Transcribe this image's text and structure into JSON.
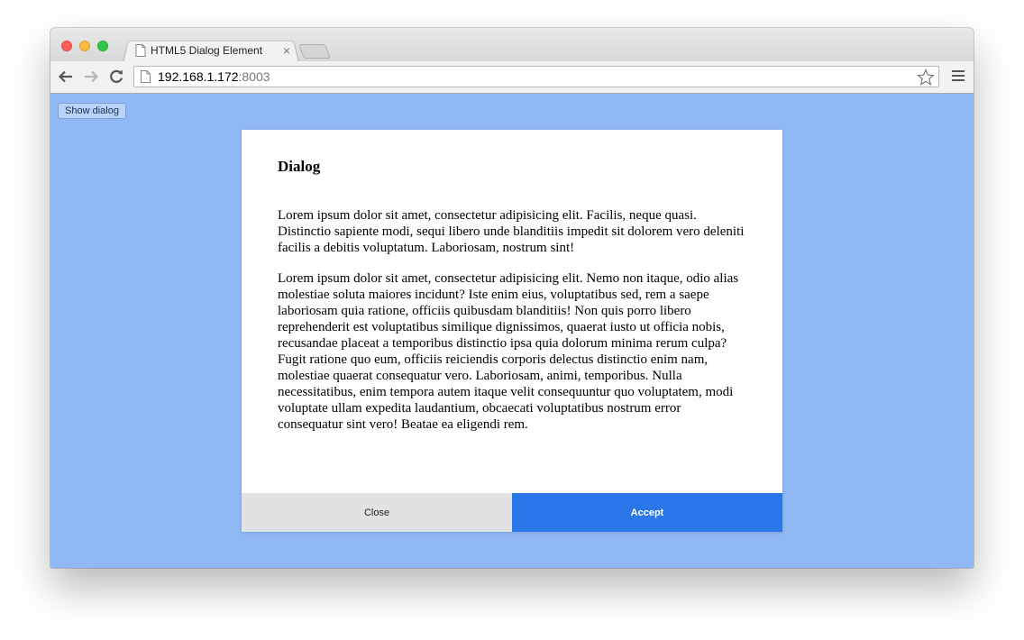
{
  "browser": {
    "tab_title": "HTML5 Dialog Element",
    "tab_close_glyph": "×",
    "url_host": "192.168.1.172",
    "url_port": ":8003"
  },
  "page": {
    "show_dialog_label": "Show dialog",
    "background_color": "#90b8f5"
  },
  "dialog": {
    "title": "Dialog",
    "paragraphs": [
      "Lorem ipsum dolor sit amet, consectetur adipisicing elit. Facilis, neque quasi. Distinctio sapiente modi, sequi libero unde blanditiis impedit sit dolorem vero deleniti facilis a debitis voluptatum. Laboriosam, nostrum sint!",
      "Lorem ipsum dolor sit amet, consectetur adipisicing elit. Nemo non itaque, odio alias molestiae soluta maiores incidunt? Iste enim eius, voluptatibus sed, rem a saepe laboriosam quia ratione, officiis quibusdam blanditiis! Non quis porro libero reprehenderit est voluptatibus similique dignissimos, quaerat iusto ut officia nobis, recusandae placeat a temporibus distinctio ipsa quia dolorum minima rerum culpa? Fugit ratione quo eum, officiis reiciendis corporis delectus distinctio enim nam, molestiae quaerat consequatur vero. Laboriosam, animi, temporibus. Nulla necessitatibus, enim tempora autem itaque velit consequuntur quo voluptatem, modi voluptate ullam expedita laudantium, obcaecati voluptatibus nostrum error consequatur sint vero! Beatae ea eligendi rem."
    ],
    "close_label": "Close",
    "accept_label": "Accept",
    "accept_color": "#2a77ea"
  },
  "icons": {
    "back": "back-arrow-icon",
    "forward": "forward-arrow-icon",
    "reload": "reload-icon",
    "page": "page-icon",
    "star": "star-icon",
    "menu": "hamburger-menu-icon"
  }
}
